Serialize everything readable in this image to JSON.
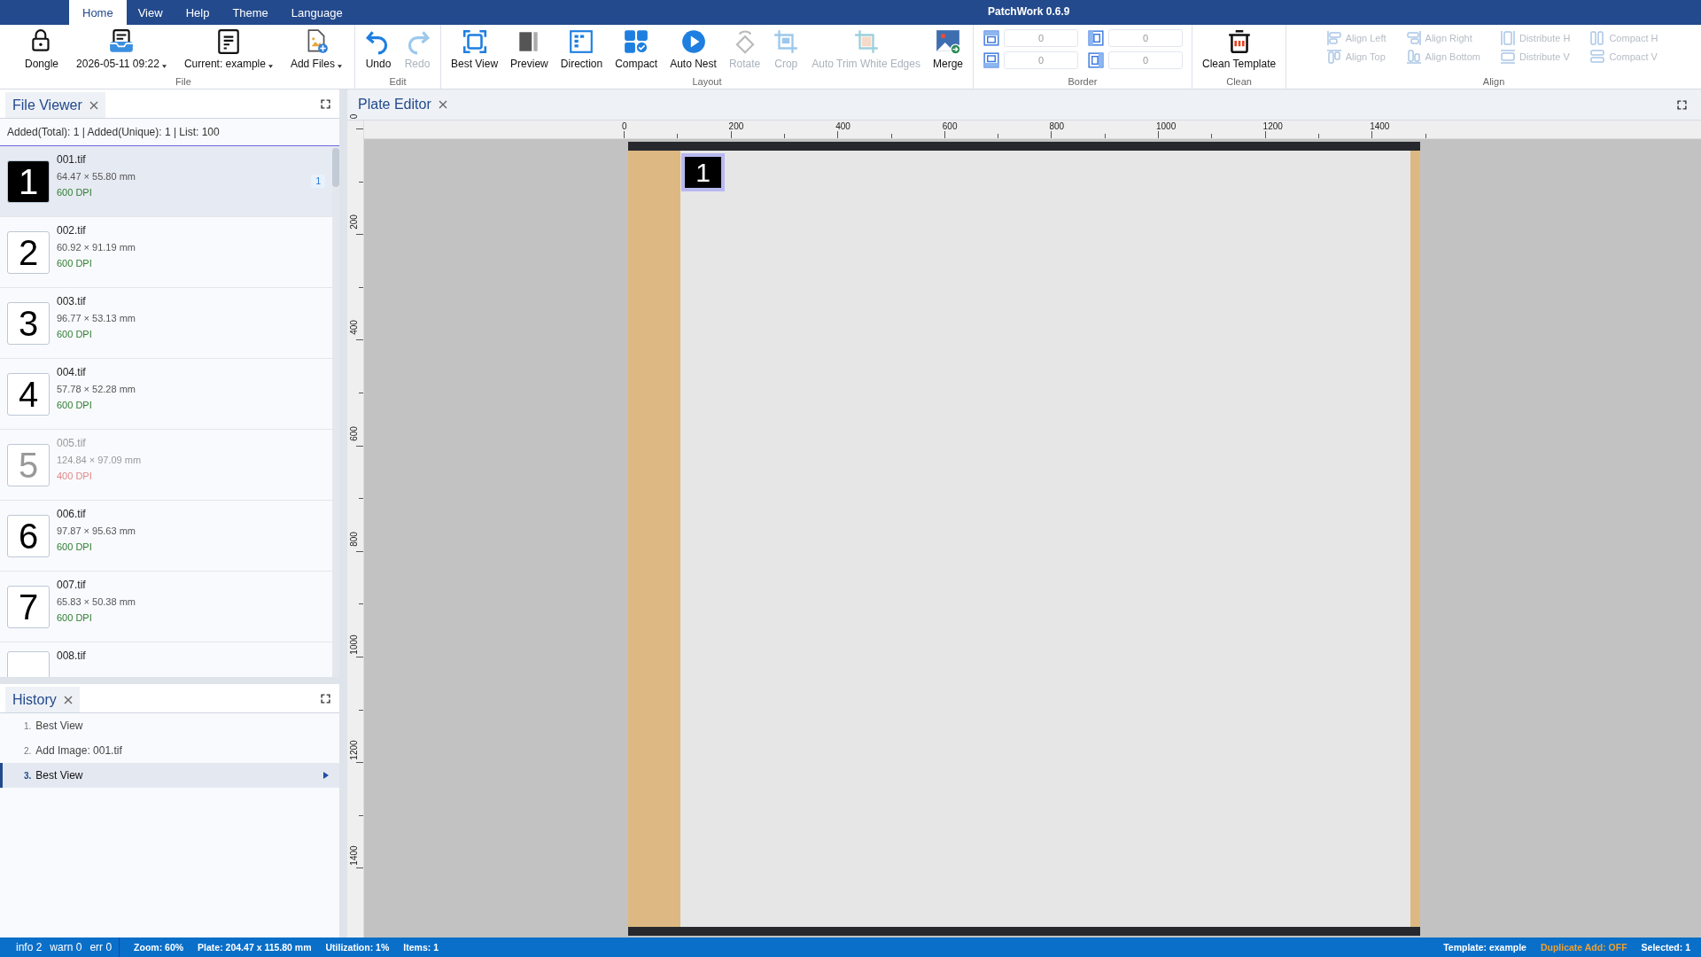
{
  "window": {
    "title": "PatchWork 0.6.9"
  },
  "menu_tabs": [
    {
      "label": "Home",
      "selected": true
    },
    {
      "label": "View",
      "selected": false
    },
    {
      "label": "Help",
      "selected": false
    },
    {
      "label": "Theme",
      "selected": false
    },
    {
      "label": "Language",
      "selected": false
    }
  ],
  "ribbon": {
    "groups": [
      {
        "label": "File",
        "kind": "buttons",
        "buttons": [
          {
            "label": "Dongle",
            "disabled": false,
            "dropdown": false
          },
          {
            "label": "2026-05-11 09:22",
            "disabled": false,
            "dropdown": true
          },
          {
            "label": "Current: example",
            "disabled": false,
            "dropdown": true
          },
          {
            "label": "Add Files",
            "disabled": false,
            "dropdown": true
          }
        ]
      },
      {
        "label": "Edit",
        "kind": "buttons",
        "buttons": [
          {
            "label": "Undo",
            "disabled": false,
            "dropdown": false
          },
          {
            "label": "Redo",
            "disabled": true,
            "dropdown": false
          }
        ]
      },
      {
        "label": "Layout",
        "kind": "buttons",
        "buttons": [
          {
            "label": "Best View",
            "disabled": false,
            "dropdown": false
          },
          {
            "label": "Preview",
            "disabled": false,
            "dropdown": false
          },
          {
            "label": "Direction",
            "disabled": false,
            "dropdown": false
          },
          {
            "label": "Compact",
            "disabled": false,
            "dropdown": false
          },
          {
            "label": "Auto Nest",
            "disabled": false,
            "dropdown": false
          },
          {
            "label": "Rotate",
            "disabled": true,
            "dropdown": false
          },
          {
            "label": "Crop",
            "disabled": true,
            "dropdown": false
          },
          {
            "label": "Auto Trim White Edges",
            "disabled": true,
            "dropdown": false
          },
          {
            "label": "Merge",
            "disabled": false,
            "dropdown": false
          }
        ]
      },
      {
        "label": "Border",
        "kind": "fields",
        "fields": [
          {
            "value": "0"
          },
          {
            "value": "0"
          },
          {
            "value": "0"
          },
          {
            "value": "0"
          }
        ]
      },
      {
        "label": "Clean",
        "kind": "buttons",
        "buttons": [
          {
            "label": "Clean Template",
            "disabled": false,
            "dropdown": false
          }
        ]
      },
      {
        "label": "Align",
        "kind": "small_buttons",
        "buttons": [
          {
            "label": "Align Left",
            "disabled": true
          },
          {
            "label": "Align Right",
            "disabled": true
          },
          {
            "label": "Distribute H",
            "disabled": true
          },
          {
            "label": "Compact H",
            "disabled": true
          },
          {
            "label": "Align Top",
            "disabled": true
          },
          {
            "label": "Align Bottom",
            "disabled": true
          },
          {
            "label": "Distribute V",
            "disabled": true
          },
          {
            "label": "Compact V",
            "disabled": true
          }
        ]
      }
    ]
  },
  "file_viewer": {
    "title": "File Viewer",
    "summary": "Added(Total): 1 | Added(Unique): 1 | List: 100",
    "files": [
      {
        "thumb": "1",
        "name": "001.tif",
        "size": "64.47 × 55.80 mm",
        "dpi": "600 DPI",
        "count": "1",
        "selected": true,
        "dark": true,
        "disabled": false
      },
      {
        "thumb": "2",
        "name": "002.tif",
        "size": "60.92 × 91.19 mm",
        "dpi": "600 DPI",
        "selected": false,
        "dark": false,
        "disabled": false
      },
      {
        "thumb": "3",
        "name": "003.tif",
        "size": "96.77 × 53.13 mm",
        "dpi": "600 DPI",
        "selected": false,
        "dark": false,
        "disabled": false
      },
      {
        "thumb": "4",
        "name": "004.tif",
        "size": "57.78 × 52.28 mm",
        "dpi": "600 DPI",
        "selected": false,
        "dark": false,
        "disabled": false
      },
      {
        "thumb": "5",
        "name": "005.tif",
        "size": "124.84 × 97.09 mm",
        "dpi": "400 DPI",
        "selected": false,
        "dark": false,
        "disabled": true
      },
      {
        "thumb": "6",
        "name": "006.tif",
        "size": "97.87 × 95.63 mm",
        "dpi": "600 DPI",
        "selected": false,
        "dark": false,
        "disabled": false
      },
      {
        "thumb": "7",
        "name": "007.tif",
        "size": "65.83 × 50.38 mm",
        "dpi": "600 DPI",
        "selected": false,
        "dark": false,
        "disabled": false
      },
      {
        "name": "008.tif",
        "selected": false,
        "dark": false,
        "disabled": false
      }
    ]
  },
  "history": {
    "title": "History",
    "steps": [
      {
        "number": "1.",
        "label": "Best View",
        "selected": false
      },
      {
        "number": "2.",
        "label": "Add Image: 001.tif",
        "selected": false
      },
      {
        "number": "3.",
        "label": "Best View",
        "selected": true
      }
    ]
  },
  "plate_editor": {
    "title": "Plate Editor",
    "x_ruler": [
      "0",
      "200",
      "400",
      "600",
      "800",
      "1000",
      "1200",
      "1400"
    ],
    "y_ruler": [
      "0",
      "200",
      "400",
      "600",
      "800",
      "1000",
      "1200",
      "1400"
    ],
    "items": [
      {
        "label": "1",
        "selected": true
      }
    ]
  },
  "status_bar": {
    "log": [
      "info 2",
      "warn 0",
      "err 0"
    ],
    "left": [
      {
        "text": "Zoom: 60%",
        "kind": "normal"
      },
      {
        "text": "Plate: 204.47 x 115.80 mm",
        "kind": "normal"
      },
      {
        "text": "Utilization: 1%",
        "kind": "normal"
      },
      {
        "text": "Items: 1",
        "kind": "normal"
      }
    ],
    "right": [
      {
        "text": "Template: example",
        "kind": "normal"
      },
      {
        "text": "Duplicate Add: OFF",
        "kind": "warning"
      },
      {
        "text": "Selected: 1",
        "kind": "normal"
      }
    ]
  }
}
